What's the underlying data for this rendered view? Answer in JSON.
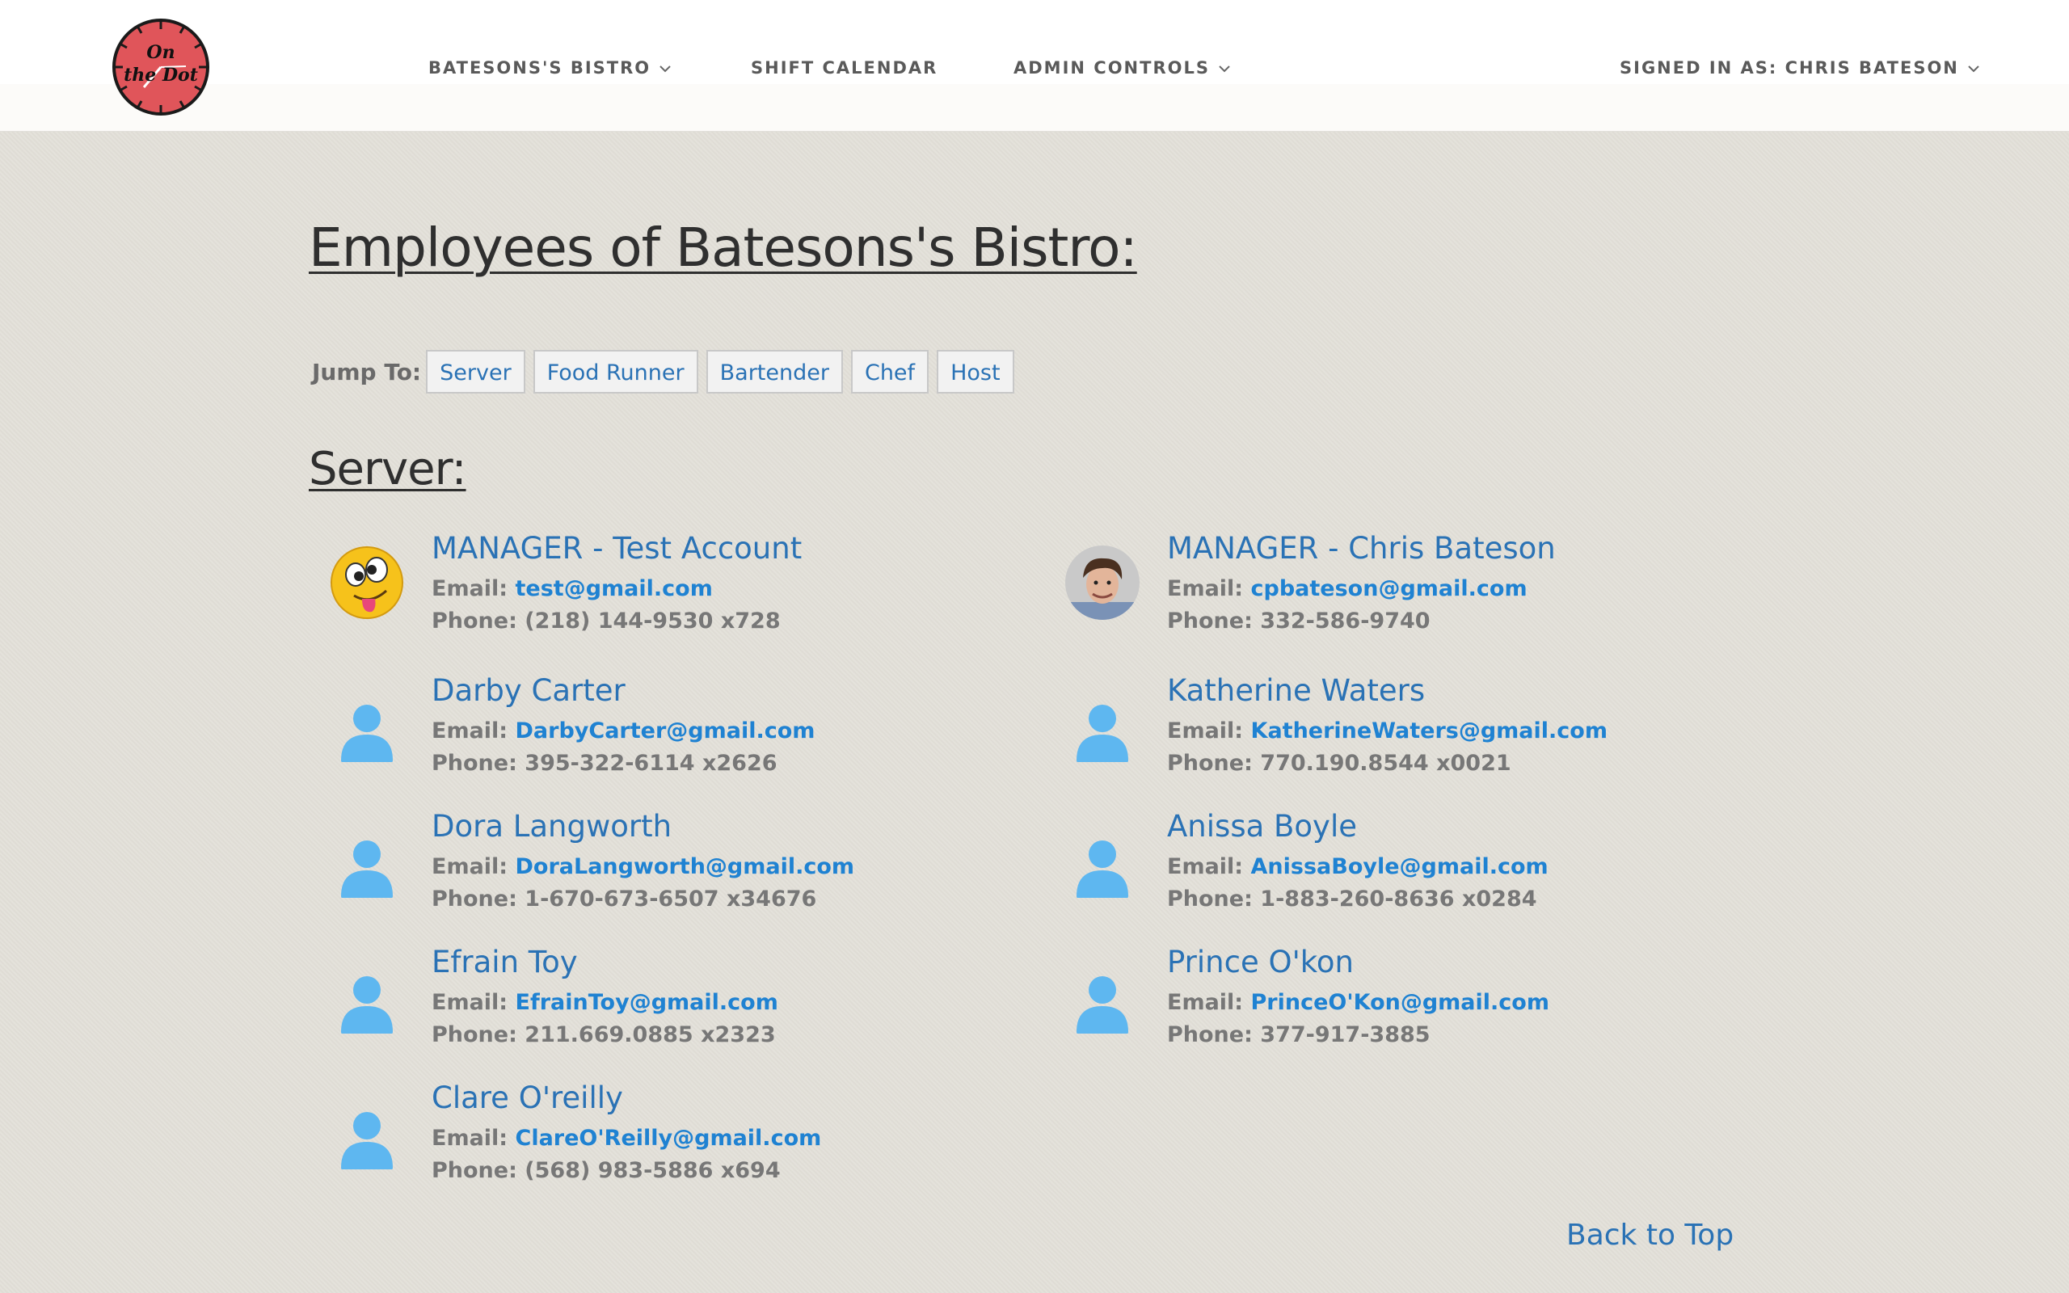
{
  "header": {
    "logo_text_line1": "On",
    "logo_text_line2": "the Dot",
    "nav": [
      {
        "label": "BATESONS'S BISTRO"
      },
      {
        "label": "SHIFT CALENDAR"
      },
      {
        "label": "ADMIN CONTROLS"
      }
    ],
    "user_menu": "SIGNED IN AS: CHRIS BATESON"
  },
  "page": {
    "title": "Employees of Batesons's Bistro:",
    "jump_label": "Jump To:",
    "jump_links": [
      "Server",
      "Food Runner",
      "Bartender",
      "Chef",
      "Host"
    ],
    "section_title": "Server:",
    "email_label": "Email:",
    "phone_label": "Phone:",
    "employees": [
      {
        "name": "MANAGER - Test Account",
        "email": "test@gmail.com",
        "phone": "(218) 144-9530 x728",
        "avatar": "emoji-face-icon"
      },
      {
        "name": "MANAGER - Chris Bateson",
        "email": "cpbateson@gmail.com",
        "phone": "332-586-9740",
        "avatar": "user-photo"
      },
      {
        "name": "Darby Carter",
        "email": "DarbyCarter@gmail.com",
        "phone": "395-322-6114 x2626",
        "avatar": "person-icon"
      },
      {
        "name": "Katherine Waters",
        "email": "KatherineWaters@gmail.com",
        "phone": "770.190.8544 x0021",
        "avatar": "person-icon"
      },
      {
        "name": "Dora Langworth",
        "email": "DoraLangworth@gmail.com",
        "phone": "1-670-673-6507 x34676",
        "avatar": "person-icon"
      },
      {
        "name": "Anissa Boyle",
        "email": "AnissaBoyle@gmail.com",
        "phone": "1-883-260-8636 x0284",
        "avatar": "person-icon"
      },
      {
        "name": "Efrain Toy",
        "email": "EfrainToy@gmail.com",
        "phone": "211.669.0885 x2323",
        "avatar": "person-icon"
      },
      {
        "name": "Prince O'kon",
        "email": "PrinceO'Kon@gmail.com",
        "phone": "377-917-3885",
        "avatar": "person-icon"
      },
      {
        "name": "Clare O'reilly",
        "email": "ClareO'Reilly@gmail.com",
        "phone": "(568) 983-5886 x694",
        "avatar": "person-icon"
      }
    ],
    "back_to_top": "Back to Top"
  },
  "colors": {
    "accent_link": "#2a72b5",
    "email_link": "#1f82d2",
    "person_icon": "#5eb7f0",
    "logo_red": "#e0555a",
    "background": "#e3e0d9"
  }
}
